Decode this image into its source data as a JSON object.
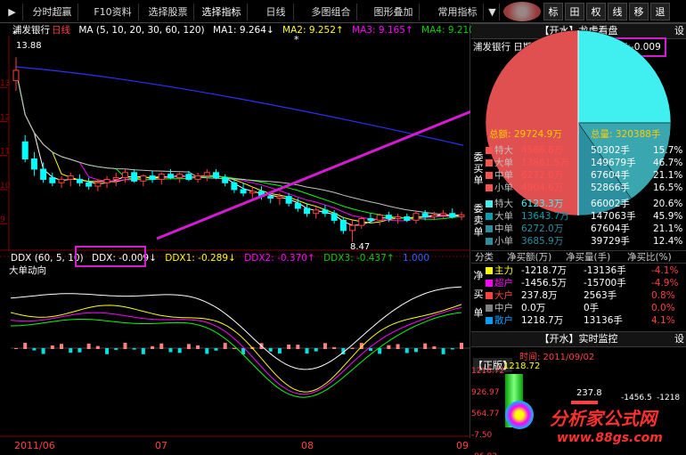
{
  "colors": {
    "up": "#ff4040",
    "down": "#00ffff",
    "ma_white": "#ffffff",
    "ma_yellow": "#ffff00",
    "ma_magenta": "#ff00ff",
    "ma_green": "#00ff00",
    "ma_blue": "#3030ff",
    "highlight": "#d21bd2",
    "pie_red": "#e05050",
    "pie_cyan": "#40f0f0",
    "pie_teal": "#3aa6b0"
  },
  "toolbar": {
    "items": [
      "分时超赢",
      "F10资料",
      "选择股票",
      "选择指标",
      "日线",
      "多图组合",
      "图形叠加",
      "常用指标"
    ],
    "right_buttons": [
      "标",
      "田",
      "权",
      "线",
      "移",
      "退"
    ]
  },
  "main_chart": {
    "stock_name": "浦发银行",
    "period": "日线",
    "ma_label": "MA (5, 10, 20, 30, 60, 120)",
    "ma1": "MA1: 9.264↓",
    "ma2": "MA2: 9.252↑",
    "ma3": "MA3: 9.165↑",
    "ma4": "MA4: 9.210↓",
    "max_price": "13.88",
    "min_price": "8.47",
    "y_ticks": [
      "13",
      "12",
      "11",
      "10",
      "9"
    ],
    "ddx_indicator": "DDX (60, 5, 10)",
    "ddx": "DDX: -0.009↓",
    "ddx1": "DDX1: -0.289↓",
    "ddx2": "DDX2: -0.370↑",
    "ddx3": "DDX3: -0.437↑",
    "ddx_extra": "1.000",
    "big_order_label": "大单动向",
    "x_labels": [
      "2011/06",
      "07",
      "08",
      "09"
    ]
  },
  "chart_data": {
    "type": "candlestick",
    "title": "浦发银行 日线",
    "candles": [
      {
        "o": 13.2,
        "h": 13.88,
        "l": 12.9,
        "c": 13.5
      },
      {
        "o": 11.4,
        "h": 11.6,
        "l": 10.8,
        "c": 10.9
      },
      {
        "o": 10.9,
        "h": 11.1,
        "l": 10.4,
        "c": 10.6
      },
      {
        "o": 10.6,
        "h": 10.8,
        "l": 10.2,
        "c": 10.3
      },
      {
        "o": 10.35,
        "h": 10.5,
        "l": 10.1,
        "c": 10.2
      },
      {
        "o": 10.2,
        "h": 10.4,
        "l": 10.05,
        "c": 10.3
      },
      {
        "o": 10.3,
        "h": 10.5,
        "l": 10.1,
        "c": 10.4
      },
      {
        "o": 10.3,
        "h": 10.45,
        "l": 10.1,
        "c": 10.2
      },
      {
        "o": 10.2,
        "h": 10.35,
        "l": 10.0,
        "c": 10.1
      },
      {
        "o": 10.1,
        "h": 10.3,
        "l": 9.95,
        "c": 10.2
      },
      {
        "o": 10.2,
        "h": 10.4,
        "l": 10.05,
        "c": 10.3
      },
      {
        "o": 10.3,
        "h": 10.5,
        "l": 10.1,
        "c": 10.35
      },
      {
        "o": 10.35,
        "h": 10.6,
        "l": 10.2,
        "c": 10.5
      },
      {
        "o": 10.5,
        "h": 10.6,
        "l": 10.2,
        "c": 10.25
      },
      {
        "o": 10.25,
        "h": 10.45,
        "l": 10.1,
        "c": 10.4
      },
      {
        "o": 10.4,
        "h": 10.55,
        "l": 10.2,
        "c": 10.3
      },
      {
        "o": 10.3,
        "h": 10.5,
        "l": 10.15,
        "c": 10.45
      },
      {
        "o": 10.45,
        "h": 10.6,
        "l": 10.3,
        "c": 10.35
      },
      {
        "o": 10.35,
        "h": 10.5,
        "l": 10.2,
        "c": 10.45
      },
      {
        "o": 10.45,
        "h": 10.55,
        "l": 10.25,
        "c": 10.3
      },
      {
        "o": 10.3,
        "h": 10.5,
        "l": 10.2,
        "c": 10.4
      },
      {
        "o": 10.4,
        "h": 10.6,
        "l": 10.25,
        "c": 10.5
      },
      {
        "o": 10.5,
        "h": 10.6,
        "l": 10.3,
        "c": 10.35
      },
      {
        "o": 10.35,
        "h": 10.45,
        "l": 10.1,
        "c": 10.2
      },
      {
        "o": 10.2,
        "h": 10.3,
        "l": 9.9,
        "c": 10.0
      },
      {
        "o": 10.0,
        "h": 10.2,
        "l": 9.8,
        "c": 9.9
      },
      {
        "o": 9.9,
        "h": 10.1,
        "l": 9.75,
        "c": 9.95
      },
      {
        "o": 9.95,
        "h": 10.1,
        "l": 9.7,
        "c": 9.8
      },
      {
        "o": 9.8,
        "h": 9.95,
        "l": 9.6,
        "c": 9.75
      },
      {
        "o": 9.75,
        "h": 9.9,
        "l": 9.55,
        "c": 9.8
      },
      {
        "o": 9.8,
        "h": 9.9,
        "l": 9.5,
        "c": 9.6
      },
      {
        "o": 9.6,
        "h": 9.75,
        "l": 9.35,
        "c": 9.45
      },
      {
        "o": 9.45,
        "h": 9.6,
        "l": 9.2,
        "c": 9.3
      },
      {
        "o": 9.3,
        "h": 9.5,
        "l": 9.15,
        "c": 9.4
      },
      {
        "o": 9.4,
        "h": 9.55,
        "l": 9.2,
        "c": 9.3
      },
      {
        "o": 9.3,
        "h": 9.4,
        "l": 9.0,
        "c": 9.1
      },
      {
        "o": 9.1,
        "h": 9.2,
        "l": 8.7,
        "c": 8.8
      },
      {
        "o": 8.8,
        "h": 9.1,
        "l": 8.47,
        "c": 8.95
      },
      {
        "o": 8.95,
        "h": 9.2,
        "l": 8.85,
        "c": 9.15
      },
      {
        "o": 9.15,
        "h": 9.3,
        "l": 9.0,
        "c": 9.1
      },
      {
        "o": 9.1,
        "h": 9.3,
        "l": 8.95,
        "c": 9.25
      },
      {
        "o": 9.25,
        "h": 9.35,
        "l": 9.05,
        "c": 9.15
      },
      {
        "o": 9.15,
        "h": 9.3,
        "l": 9.0,
        "c": 9.2
      },
      {
        "o": 9.2,
        "h": 9.3,
        "l": 9.05,
        "c": 9.1
      },
      {
        "o": 9.1,
        "h": 9.35,
        "l": 9.0,
        "c": 9.3
      },
      {
        "o": 9.3,
        "h": 9.4,
        "l": 9.1,
        "c": 9.2
      },
      {
        "o": 9.2,
        "h": 9.35,
        "l": 9.1,
        "c": 9.25
      },
      {
        "o": 9.25,
        "h": 9.4,
        "l": 9.15,
        "c": 9.3
      },
      {
        "o": 9.3,
        "h": 9.45,
        "l": 9.15,
        "c": 9.2
      },
      {
        "o": 9.2,
        "h": 9.35,
        "l": 9.1,
        "c": 9.26
      }
    ],
    "ylim": [
      8.3,
      14.1
    ]
  },
  "right_panel": {
    "header1_title": "【开水】龙虎看盘",
    "header1_set": "设",
    "stock_date": "浦发银行  日期: 2011/9/2",
    "ddx_value": "DDX:-0.009",
    "total_amount": "总额: 29724.9万",
    "total_volume": "总量: 320388手",
    "pie_slices": [
      {
        "name": "特大",
        "value": 20.6,
        "side": "buy"
      },
      {
        "name": "大单",
        "value": 45.9,
        "side": "buy"
      },
      {
        "name": "中单",
        "value": 21.1,
        "side": "buy"
      },
      {
        "name": "小单",
        "value": 12.4,
        "side": "buy"
      }
    ],
    "buy_label": [
      "委",
      "买",
      "单"
    ],
    "sell_label": [
      "委",
      "卖",
      "单"
    ],
    "buy_rows": [
      {
        "name": "特大",
        "amount": "4566.8万",
        "vol": "50302手",
        "pct": "15.7%"
      },
      {
        "name": "大单",
        "amount": "13881.5万",
        "vol": "149679手",
        "pct": "46.7%"
      },
      {
        "name": "中单",
        "amount": "6272.0万",
        "vol": "67604手",
        "pct": "21.1%"
      },
      {
        "name": "小单",
        "amount": "4904.6万",
        "vol": "52866手",
        "pct": "16.5%"
      }
    ],
    "sell_rows": [
      {
        "name": "特大",
        "amount": "6123.3万",
        "vol": "66002手",
        "pct": "20.6%"
      },
      {
        "name": "大单",
        "amount": "13643.7万",
        "vol": "147063手",
        "pct": "45.9%"
      },
      {
        "name": "中单",
        "amount": "6272.0万",
        "vol": "67604手",
        "pct": "21.1%"
      },
      {
        "name": "小单",
        "amount": "3685.9万",
        "vol": "39729手",
        "pct": "12.4%"
      }
    ],
    "net_header": [
      "分类",
      "净买额(万)",
      "净买量(手)",
      "净买比(%)"
    ],
    "net_label": [
      "净",
      "买",
      "单"
    ],
    "net_rows": [
      {
        "name": "主力",
        "amount": "-1218.7万",
        "vol": "-13136手",
        "pct": "-4.1%",
        "color": "#ffff00"
      },
      {
        "name": "超户",
        "amount": "-1456.5万",
        "vol": "-15700手",
        "pct": "-4.9%",
        "color": "#ff00ff"
      },
      {
        "name": "大户",
        "amount": "237.8万",
        "vol": "2563手",
        "pct": "0.8%",
        "color": "#ff4040"
      },
      {
        "name": "中户",
        "amount": "0.0万",
        "vol": "0手",
        "pct": "0.0%",
        "color": "#808080"
      },
      {
        "name": "散户",
        "amount": "1218.7万",
        "vol": "13136手",
        "pct": "4.1%",
        "color": "#00a0ff"
      }
    ],
    "header2_title": "【开水】实时监控",
    "header2_set": "设",
    "monitor_time": "时间: 2011/09/02",
    "monitor_tag": "【正版】",
    "monitor_values": [
      "1218.72",
      "237.8",
      "-1456.5",
      "-1218"
    ],
    "monitor_ticks": [
      "1216.72",
      "926.97",
      "564.77",
      "-7.50",
      "-96.82"
    ],
    "watermark": "分析家公式网",
    "watermark_url": "www.88gs.com"
  }
}
